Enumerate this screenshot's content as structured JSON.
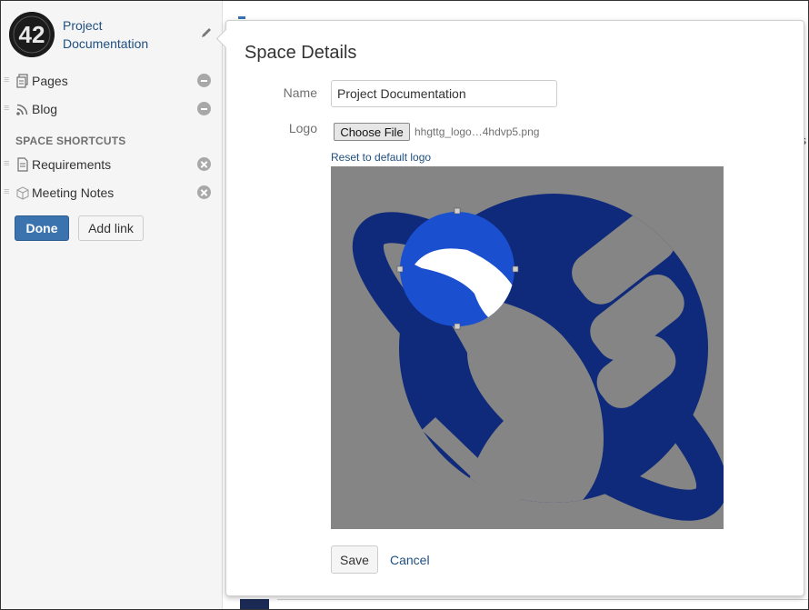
{
  "sidebar": {
    "space_title": "Project Documentation",
    "items": [
      {
        "label": "Pages",
        "icon": "pages-icon",
        "action": "minus"
      },
      {
        "label": "Blog",
        "icon": "rss-icon",
        "action": "minus"
      }
    ],
    "shortcuts_heading": "SPACE SHORTCUTS",
    "shortcuts": [
      {
        "label": "Requirements",
        "icon": "document-icon",
        "action": "remove"
      },
      {
        "label": "Meeting Notes",
        "icon": "box-icon",
        "action": "remove"
      }
    ],
    "done_label": "Done",
    "add_link_label": "Add link"
  },
  "dialog": {
    "title": "Space Details",
    "name_label": "Name",
    "name_value": "Project Documentation",
    "logo_label": "Logo",
    "choose_file_label": "Choose File",
    "file_name": "hhgttg_logo…4hdvp5.png",
    "reset_link": "Reset to default logo",
    "save_label": "Save",
    "cancel_label": "Cancel"
  },
  "background": {
    "partial_text": "s"
  },
  "colors": {
    "link": "#205081",
    "primary_button": "#3b73af",
    "logo_blue": "#0f2a7a",
    "crop_highlight": "#1a4fd0",
    "crop_background": "#858585",
    "sidebar_bg": "#f5f5f5"
  }
}
